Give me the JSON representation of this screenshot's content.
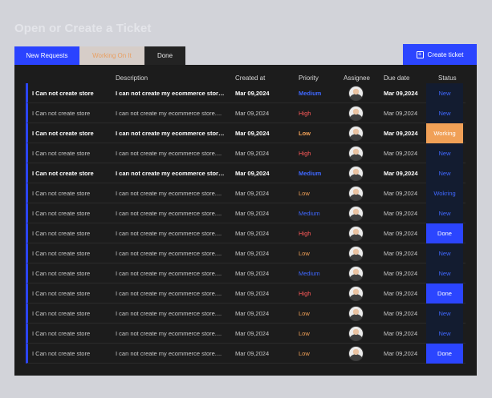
{
  "page": {
    "title": "Open or Create a Ticket"
  },
  "tabs": [
    {
      "label": "New Requests"
    },
    {
      "label": "Working On It"
    },
    {
      "label": "Done"
    }
  ],
  "create_button": {
    "label": "Create ticket",
    "icon": "plus-square-icon"
  },
  "columns": {
    "description": "Description",
    "created_at": "Created at",
    "priority": "Priority",
    "assignee": "Assignee",
    "due_date": "Due date",
    "status": "Status"
  },
  "colors": {
    "accent": "#2b45ff",
    "high": "#ff5a5a",
    "medium": "#3f68ff",
    "low": "#f0a057",
    "working": "#f0a057"
  },
  "rows": [
    {
      "title": "I Can not create store",
      "desc": "I can not create my ecommerce store....",
      "created": "Mar 09,2024",
      "priority": "Medium",
      "due": "Mar 09,2024",
      "status": "New",
      "bold": true
    },
    {
      "title": "I Can not create store",
      "desc": "I can not create my ecommerce store....",
      "created": "Mar 09,2024",
      "priority": "High",
      "due": "Mar 09,2024",
      "status": "New",
      "bold": false
    },
    {
      "title": "I Can not create store",
      "desc": "I can not create my ecommerce store....",
      "created": "Mar 09,2024",
      "priority": "Low",
      "due": "Mar 09,2024",
      "status": "Working",
      "bold": true
    },
    {
      "title": "I Can not create store",
      "desc": "I can not create my ecommerce store....",
      "created": "Mar 09,2024",
      "priority": "High",
      "due": "Mar 09,2024",
      "status": "New",
      "bold": false
    },
    {
      "title": "I Can not create store",
      "desc": "I can not create my ecommerce store....",
      "created": "Mar 09,2024",
      "priority": "Medium",
      "due": "Mar 09,2024",
      "status": "New",
      "bold": true
    },
    {
      "title": "I Can not create store",
      "desc": "I can not create my ecommerce store....",
      "created": "Mar 09,2024",
      "priority": "Low",
      "due": "Mar 09,2024",
      "status": "Wokring",
      "bold": false
    },
    {
      "title": "I Can not create store",
      "desc": "I can not create my ecommerce store....",
      "created": "Mar 09,2024",
      "priority": "Medium",
      "due": "Mar 09,2024",
      "status": "New",
      "bold": false
    },
    {
      "title": "I Can not create store",
      "desc": "I can not create my ecommerce store....",
      "created": "Mar 09,2024",
      "priority": "High",
      "due": "Mar 09,2024",
      "status": "Done",
      "bold": false
    },
    {
      "title": "I Can not create store",
      "desc": "I can not create my ecommerce store....",
      "created": "Mar 09,2024",
      "priority": "Low",
      "due": "Mar 09,2024",
      "status": "New",
      "bold": false
    },
    {
      "title": "I Can not create store",
      "desc": "I can not create my ecommerce store....",
      "created": "Mar 09,2024",
      "priority": "Medium",
      "due": "Mar 09,2024",
      "status": "New",
      "bold": false
    },
    {
      "title": "I Can not create store",
      "desc": "I can not create my ecommerce store....",
      "created": "Mar 09,2024",
      "priority": "High",
      "due": "Mar 09,2024",
      "status": "Done",
      "bold": false
    },
    {
      "title": "I Can not create store",
      "desc": "I can not create my ecommerce store....",
      "created": "Mar 09,2024",
      "priority": "Low",
      "due": "Mar 09,2024",
      "status": "New",
      "bold": false
    },
    {
      "title": "I Can not create store",
      "desc": "I can not create my ecommerce store....",
      "created": "Mar 09,2024",
      "priority": "Low",
      "due": "Mar 09,2024",
      "status": "New",
      "bold": false
    },
    {
      "title": "I Can not create store",
      "desc": "I can not create my ecommerce store....",
      "created": "Mar 09,2024",
      "priority": "Low",
      "due": "Mar 09,2024",
      "status": "Done",
      "bold": false
    }
  ]
}
